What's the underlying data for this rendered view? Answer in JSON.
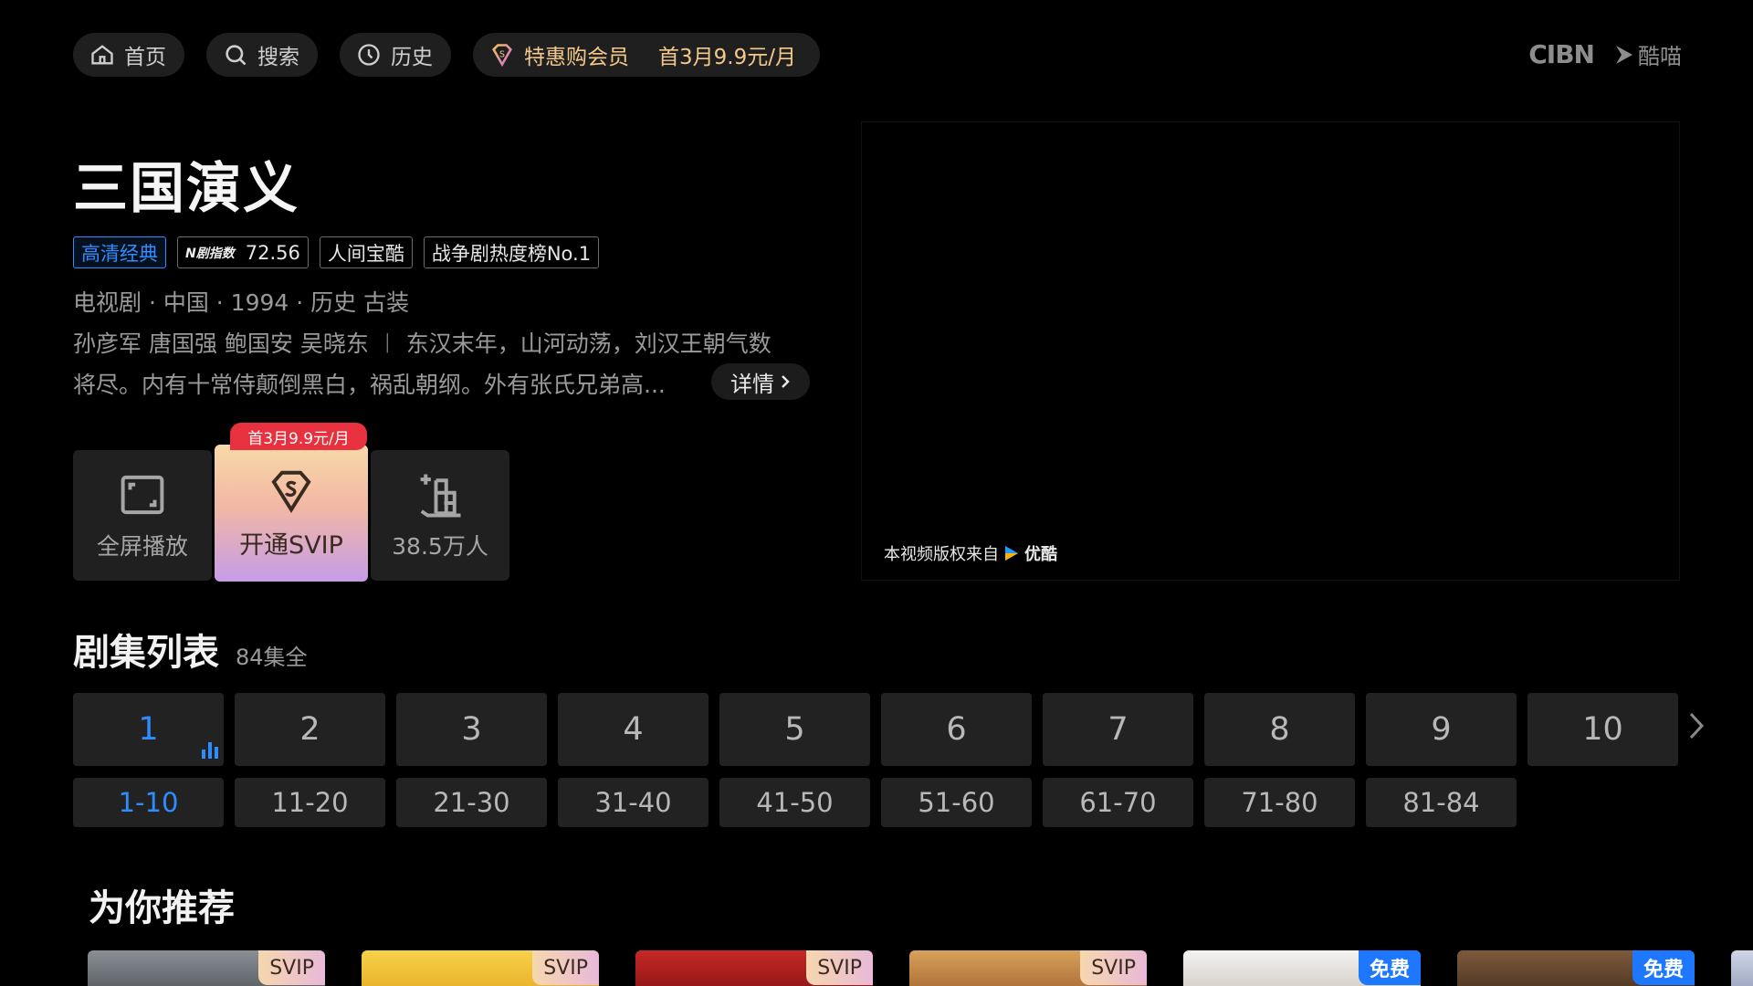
{
  "nav": {
    "home": "首页",
    "search": "搜索",
    "history": "历史",
    "vip_label": "特惠购会员",
    "vip_price": "首3月9.9元/月"
  },
  "brand": {
    "cibn": "CIBN",
    "kumiao": "酷喵"
  },
  "show": {
    "title": "三国演义",
    "tags": {
      "hd": "高清经典",
      "index_value": "72.56",
      "treasure": "人间宝酷",
      "rank": "战争剧热度榜No.1"
    },
    "index_logo": "N剧指数",
    "meta": "电视剧 · 中国 · 1994 · 历史 古装",
    "desc_line1": "孙彦军  唐国强  鲍国安  吴晓东 ︱ 东汉末年，山河动荡，刘汉王朝气数",
    "desc_line2": "将尽。内有十常侍颠倒黑白，祸乱朝纲。外有张氏兄弟高...",
    "detail_label": "详情"
  },
  "actions": {
    "fullscreen": "全屏播放",
    "svip": "开通SVIP",
    "svip_badge": "首3月9.9元/月",
    "follow": "38.5万人"
  },
  "video": {
    "copyright": "本视频版权来自",
    "provider": "优酷"
  },
  "episodes": {
    "title": "剧集列表",
    "count": "84集全",
    "items": [
      "1",
      "2",
      "3",
      "4",
      "5",
      "6",
      "7",
      "8",
      "9",
      "10"
    ],
    "active_index": 0,
    "ranges": [
      "1-10",
      "11-20",
      "21-30",
      "31-40",
      "41-50",
      "51-60",
      "61-70",
      "71-80",
      "81-84"
    ],
    "active_range": 0
  },
  "recommend": {
    "title": "为你推荐",
    "badges": [
      "SVIP",
      "SVIP",
      "SVIP",
      "SVIP",
      "免费",
      "免费"
    ]
  },
  "colors": {
    "accent": "#2f8cff",
    "vip_gold": "#f3c98a",
    "badge_red": "#e8313f"
  }
}
